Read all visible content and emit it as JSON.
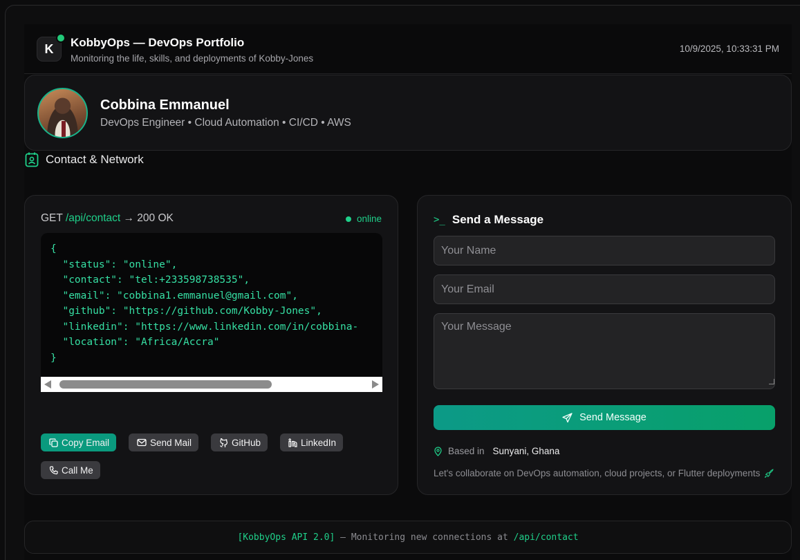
{
  "header": {
    "logo_letter": "K",
    "title": "KobbyOps — DevOps Portfolio",
    "subtitle": "Monitoring the life, skills, and deployments of Kobby-Jones",
    "datetime": "10/9/2025, 10:33:31 PM"
  },
  "profile": {
    "name": "Cobbina Emmanuel",
    "role": "DevOps Engineer • Cloud Automation • CI/CD • AWS"
  },
  "section": {
    "title": "Contact & Network",
    "icon": "contact-card-icon"
  },
  "api": {
    "method": "GET",
    "path": "/api/contact",
    "response": "→ 200 OK",
    "status": "online",
    "json_text": "{\n  \"status\": \"online\",\n  \"contact\": \"tel:+233598738535\",\n  \"email\": \"cobbina1.emmanuel@gmail.com\",\n  \"github\": \"https://github.com/Kobby-Jones\",\n  \"linkedin\": \"https://www.linkedin.com/in/cobbina-\n  \"location\": \"Africa/Accra\"\n}"
  },
  "actions": {
    "copy_email": "Copy Email",
    "send_mail": "Send Mail",
    "github": "GitHub",
    "linkedin": "LinkedIn",
    "call_me": "Call Me"
  },
  "form": {
    "prompt": ">_",
    "title": "Send a Message",
    "name_placeholder": "Your Name",
    "email_placeholder": "Your Email",
    "message_placeholder": "Your Message",
    "submit_label": "Send Message"
  },
  "location": {
    "prefix": "Based in",
    "place": "Sunyani, Ghana"
  },
  "collab_text": "Let's collaborate on DevOps automation, cloud projects, or Flutter deployments",
  "footer": {
    "tag": "[KobbyOps API 2.0]",
    "text": " — Monitoring new connections at ",
    "path": "/api/contact"
  },
  "colors": {
    "accent": "#1fd08a",
    "teal": "#0a9a7e",
    "background": "#0c0c0d",
    "card": "#131315"
  }
}
